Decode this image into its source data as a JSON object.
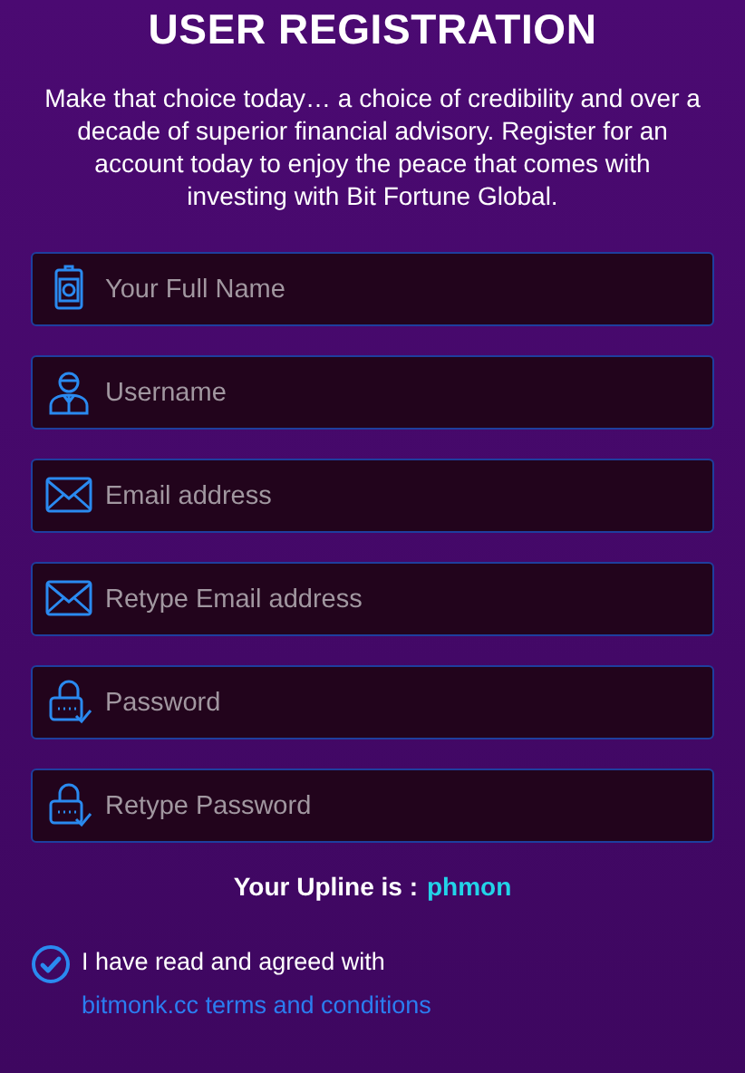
{
  "title": "USER REGISTRATION",
  "intro": "Make that choice today… a choice of credibility and over a decade of superior financial advisory. Register for an account today to enjoy the peace that comes with investing with Bit Fortune Global.",
  "fields": [
    {
      "kind": "badge",
      "placeholder": "Your Full Name"
    },
    {
      "kind": "person",
      "placeholder": "Username"
    },
    {
      "kind": "mail",
      "placeholder": "Email address"
    },
    {
      "kind": "mail",
      "placeholder": "Retype Email address"
    },
    {
      "kind": "lock",
      "placeholder": "Password"
    },
    {
      "kind": "lock",
      "placeholder": "Retype Password"
    }
  ],
  "upline": {
    "label": "Your Upline is :",
    "value": "phmon"
  },
  "agreement": {
    "checked": true,
    "text": "I have read and agreed with",
    "link": "bitmonk.cc terms and conditions"
  }
}
